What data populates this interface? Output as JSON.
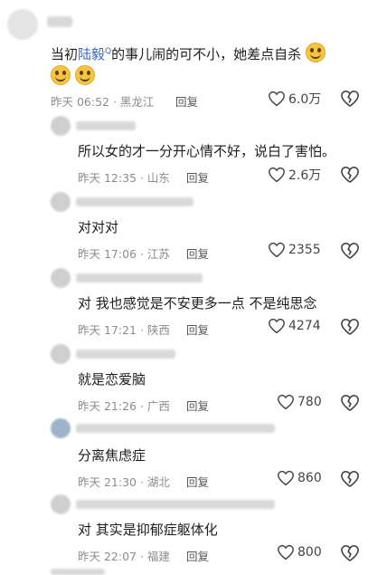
{
  "comments": [
    {
      "text_before_link": "当初",
      "link_text": "陆毅",
      "link_suffix": "Q",
      "text_after_link": "的事儿闹的可不小，她差点自杀",
      "time_loc": "昨天 06:52 · 黑龙江",
      "reply": "回复",
      "likes": "6.0万"
    },
    {
      "text": "所以女的才一分开心情不好，说白了害怕。",
      "time_loc": "昨天 12:35 · 山东",
      "reply": "回复",
      "likes": "2.6万"
    },
    {
      "text": "对对对",
      "time_loc": "昨天 17:06 · 江苏",
      "reply": "回复",
      "likes": "2355"
    },
    {
      "text": "对 我也感觉是不安更多一点 不是纯思念",
      "time_loc": "昨天 17:21 · 陕西",
      "reply": "回复",
      "likes": "4274"
    },
    {
      "text": "就是恋爱脑",
      "time_loc": "昨天 21:26 · 广西",
      "reply": "回复",
      "likes": "780"
    },
    {
      "text": "分离焦虑症",
      "time_loc": "昨天 21:30 · 湖北",
      "reply": "回复",
      "likes": "860"
    },
    {
      "text": "对 其实是抑郁症躯体化",
      "time_loc": "昨天 22:07 · 福建",
      "reply": "回复",
      "likes": "800"
    }
  ],
  "icons": {
    "like": "heart-outline-icon",
    "dislike": "broken-heart-outline-icon",
    "emoji": "smiley-emoji"
  }
}
